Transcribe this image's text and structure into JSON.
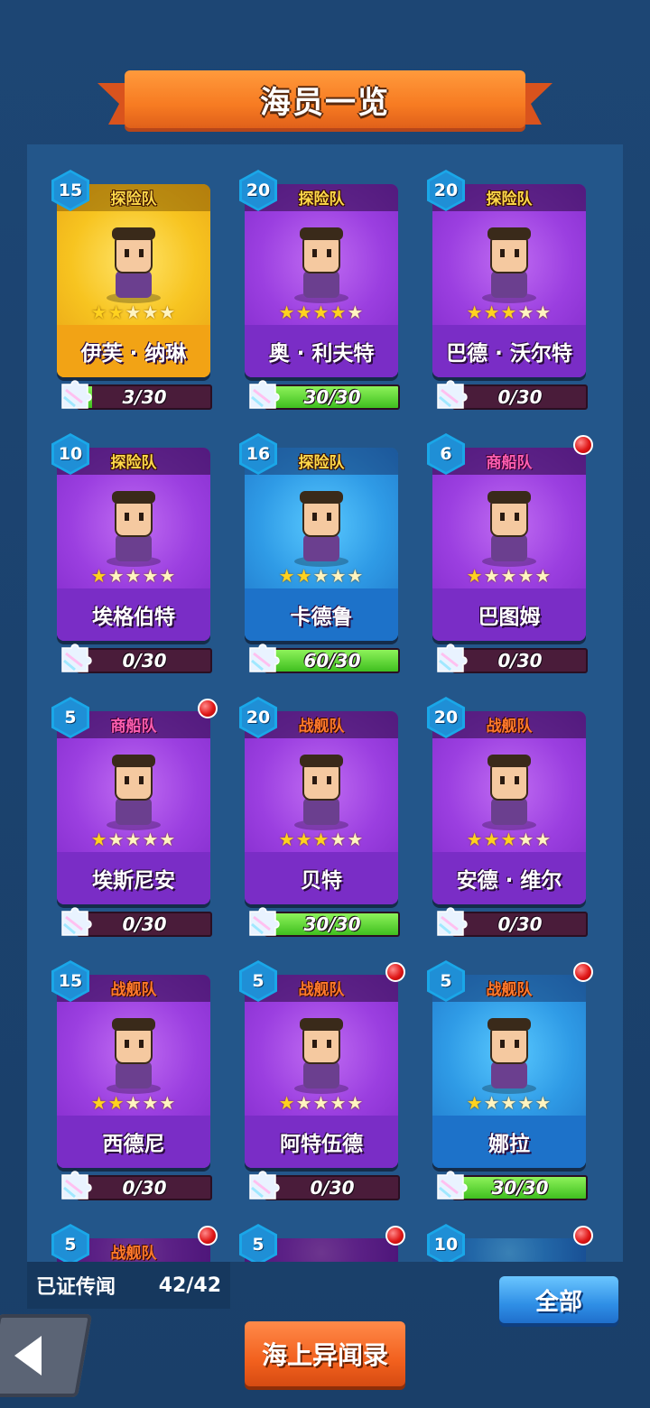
{
  "title": "海员一览",
  "cards": [
    {
      "level": "15",
      "team": "探险队",
      "team_type": "explore",
      "name": "伊芙 · 纳琳",
      "stars": 2,
      "frame": "gold",
      "progress_text": "3/30",
      "progress": 0.1,
      "alert": false
    },
    {
      "level": "20",
      "team": "探险队",
      "team_type": "explore",
      "name": "奥 · 利夫特",
      "stars": 4,
      "frame": "purple",
      "progress_text": "30/30",
      "progress": 1.0,
      "alert": false
    },
    {
      "level": "20",
      "team": "探险队",
      "team_type": "explore",
      "name": "巴德 · 沃尔特",
      "stars": 3,
      "frame": "purple",
      "progress_text": "0/30",
      "progress": 0.0,
      "alert": false
    },
    {
      "level": "10",
      "team": "探险队",
      "team_type": "explore",
      "name": "埃格伯特",
      "stars": 1,
      "frame": "purple",
      "progress_text": "0/30",
      "progress": 0.0,
      "alert": false
    },
    {
      "level": "16",
      "team": "探险队",
      "team_type": "explore",
      "name": "卡德鲁",
      "stars": 2,
      "frame": "blue",
      "progress_text": "60/30",
      "progress": 1.0,
      "alert": false
    },
    {
      "level": "6",
      "team": "商船队",
      "team_type": "merchant",
      "name": "巴图姆",
      "stars": 1,
      "frame": "purple",
      "progress_text": "0/30",
      "progress": 0.0,
      "alert": true
    },
    {
      "level": "5",
      "team": "商船队",
      "team_type": "merchant",
      "name": "埃斯尼安",
      "stars": 1,
      "frame": "purple",
      "progress_text": "0/30",
      "progress": 0.0,
      "alert": true
    },
    {
      "level": "20",
      "team": "战舰队",
      "team_type": "battle",
      "name": "贝特",
      "stars": 3,
      "frame": "purple",
      "progress_text": "30/30",
      "progress": 1.0,
      "alert": false
    },
    {
      "level": "20",
      "team": "战舰队",
      "team_type": "battle",
      "name": "安德 · 维尔",
      "stars": 3,
      "frame": "purple",
      "progress_text": "0/30",
      "progress": 0.0,
      "alert": false
    },
    {
      "level": "15",
      "team": "战舰队",
      "team_type": "battle",
      "name": "西德尼",
      "stars": 2,
      "frame": "purple",
      "progress_text": "0/30",
      "progress": 0.0,
      "alert": false
    },
    {
      "level": "5",
      "team": "战舰队",
      "team_type": "battle",
      "name": "阿特伍德",
      "stars": 1,
      "frame": "purple",
      "progress_text": "0/30",
      "progress": 0.0,
      "alert": true
    },
    {
      "level": "5",
      "team": "战舰队",
      "team_type": "battle",
      "name": "娜拉",
      "stars": 1,
      "frame": "blue",
      "progress_text": "30/30",
      "progress": 1.0,
      "alert": true
    }
  ],
  "partial_cards": [
    {
      "level": "5",
      "team": "战舰队",
      "team_type": "battle",
      "frame": "purple",
      "alert": true
    },
    {
      "level": "5",
      "team": "",
      "team_type": "battle",
      "frame": "purple",
      "alert": true
    },
    {
      "level": "10",
      "team": "",
      "team_type": "battle",
      "frame": "blue",
      "alert": true
    }
  ],
  "footer": {
    "collected_label": "已证传闻",
    "collected_value": "42/42",
    "all_button": "全部",
    "log_button": "海上异闻录",
    "back_icon": "back-arrow-icon"
  },
  "colors": {
    "background": "#1f4a78",
    "panel": "#23568a",
    "ribbon": "#f77b22",
    "progress_fill": "#3fbf1f",
    "alert": "#e01818"
  }
}
